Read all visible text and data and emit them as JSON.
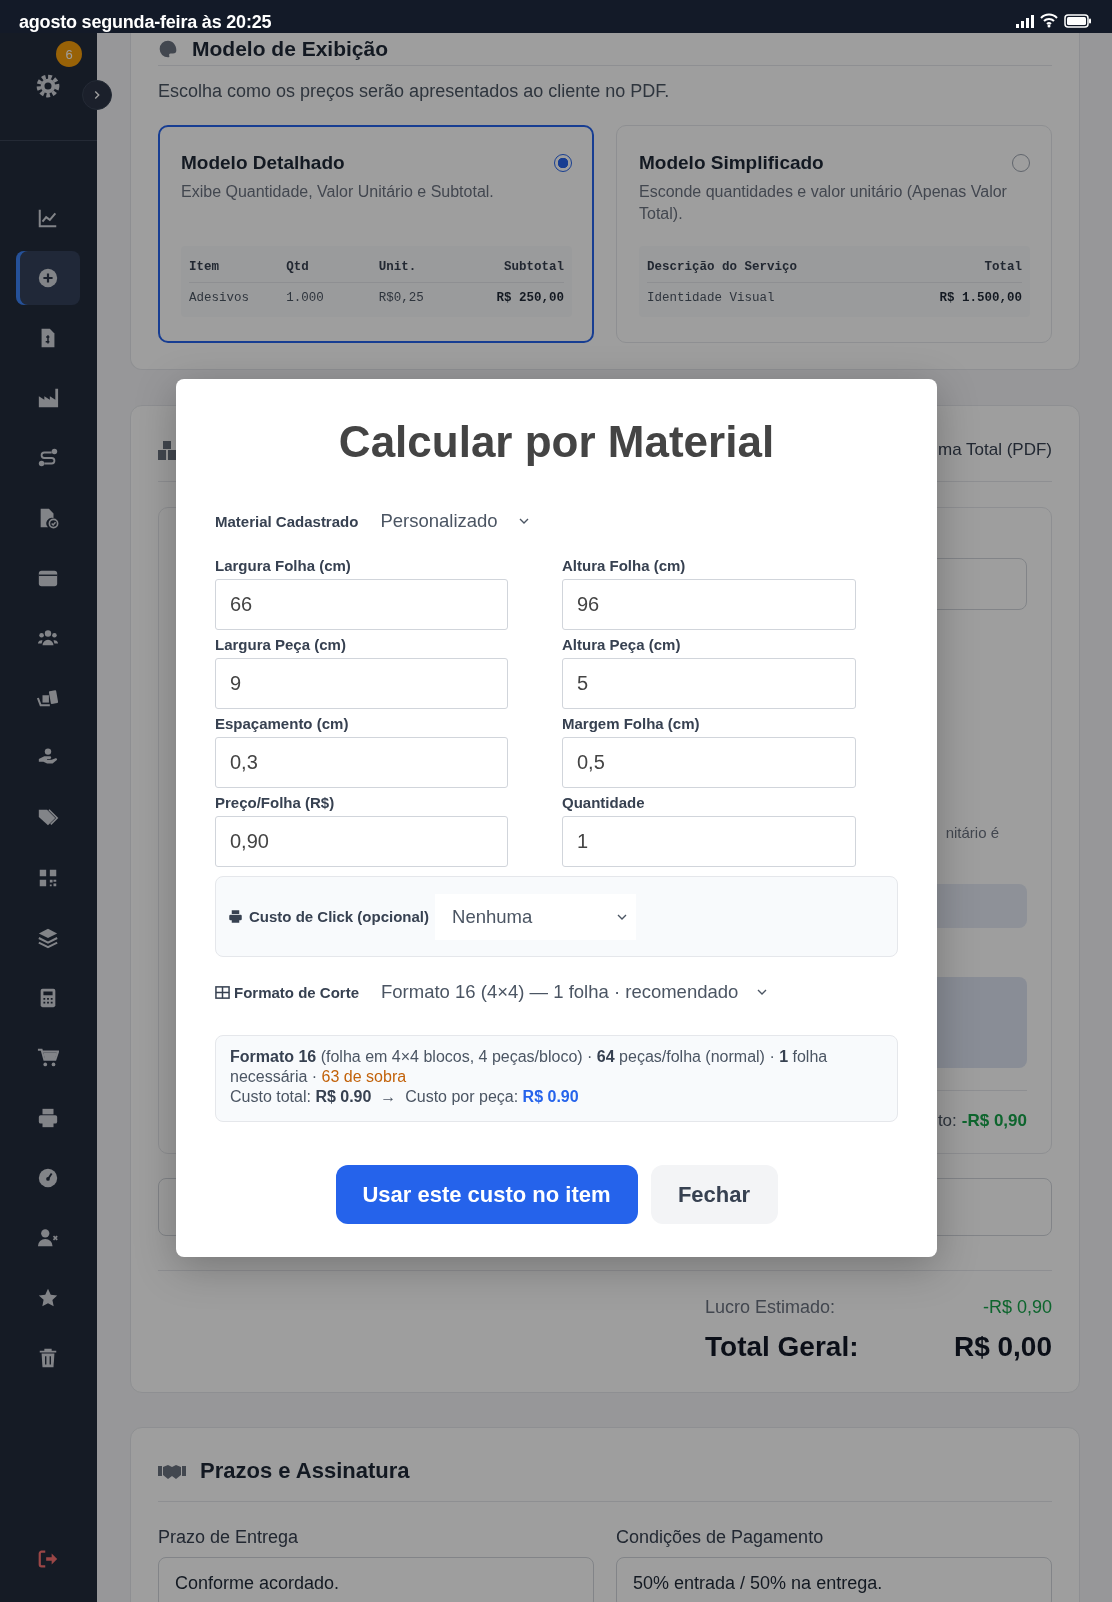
{
  "status_bar": {
    "time": "agosto segunda-feira às 20:25"
  },
  "sidebar": {
    "badge": "6",
    "items": [
      {
        "selected": false
      },
      {
        "selected": true
      },
      {
        "selected": false
      },
      {
        "selected": false
      },
      {
        "selected": false
      },
      {
        "selected": false
      },
      {
        "selected": false
      },
      {
        "selected": false
      },
      {
        "selected": false
      },
      {
        "selected": false
      },
      {
        "selected": false
      },
      {
        "selected": false
      },
      {
        "selected": false
      },
      {
        "selected": false
      },
      {
        "selected": false
      },
      {
        "selected": false
      },
      {
        "selected": false
      },
      {
        "selected": false
      },
      {
        "selected": false
      },
      {
        "selected": false
      }
    ]
  },
  "display_model": {
    "title": "Modelo de Exibição",
    "subtitle": "Escolha como os preços serão apresentados ao cliente no PDF.",
    "options": [
      {
        "title": "Modelo Detalhado",
        "description": "Exibe Quantidade, Valor Unitário e Subtotal.",
        "selected": true,
        "table": {
          "columns": [
            "Item",
            "Qtd",
            "Unit.",
            "Subtotal"
          ],
          "rows": [
            [
              "Adesivos",
              "1.000",
              "R$0,25",
              "R$ 250,00"
            ]
          ]
        }
      },
      {
        "title": "Modelo Simplificado",
        "description": "Esconde quantidades e valor unitário (Apenas Valor Total).",
        "selected": false,
        "table": {
          "columns": [
            "Descrição do Serviço",
            "Total"
          ],
          "rows": [
            [
              "Identidade Visual",
              "R$ 1.500,00"
            ]
          ]
        }
      }
    ]
  },
  "items_card": {
    "header_fragment": "ma Total (PDF)",
    "hint_fragment": "nitário é",
    "profit_fragment_label": "to:",
    "profit_fragment_value": "-R$ 0,90",
    "estimated_profit": {
      "label": "Lucro Estimado:",
      "value": "-R$ 0,90"
    },
    "grand_total": {
      "label": "Total Geral:",
      "value": "R$ 0,00"
    }
  },
  "terms": {
    "title": "Prazos e Assinatura",
    "fields": [
      {
        "label": "Prazo de Entrega",
        "value": "Conforme acordado."
      },
      {
        "label": "Condições de Pagamento",
        "value": "50% entrada / 50% na entrega."
      }
    ]
  },
  "modal": {
    "title": "Calcular por Material",
    "material": {
      "label": "Material Cadastrado",
      "value": "Personalizado"
    },
    "fields": [
      {
        "label": "Largura Folha (cm)",
        "value": "66"
      },
      {
        "label": "Altura Folha (cm)",
        "value": "96"
      },
      {
        "label": "Largura Peça (cm)",
        "value": "9"
      },
      {
        "label": "Altura Peça (cm)",
        "value": "5"
      },
      {
        "label": "Espaçamento (cm)",
        "value": "0,3"
      },
      {
        "label": "Margem Folha (cm)",
        "value": "0,5"
      },
      {
        "label": "Preço/Folha (R$)",
        "value": "0,90"
      },
      {
        "label": "Quantidade",
        "value": "1"
      }
    ],
    "click_cost": {
      "label": "Custo de Click (opcional)",
      "value": "Nenhuma"
    },
    "cut_format": {
      "label": "Formato de Corte",
      "value": "Formato 16 (4×4) — 1 folha · recomendado"
    },
    "summary": {
      "text": "**Formato 16** (folha em 4×4 blocos, 4 peças/bloco) · **64** peças/folha (normal) · **1** folha necessária ·",
      "leftover": "63 de sobra"
    },
    "cost": {
      "total_label": "Custo total:",
      "total": "R$ 0.90",
      "arrow": "→",
      "per_piece_label": "Custo por peça:",
      "per_piece": "R$ 0.90"
    },
    "buttons": [
      {
        "label": "Usar este custo no item",
        "kind": "primary"
      },
      {
        "label": "Fechar",
        "kind": "secondary"
      }
    ]
  }
}
